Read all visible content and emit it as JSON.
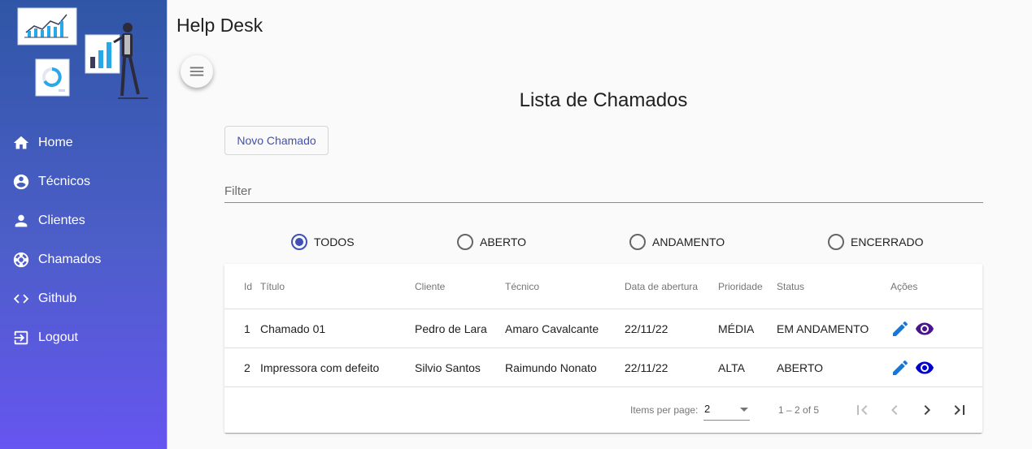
{
  "app": {
    "title": "Help Desk"
  },
  "sidebar": {
    "items": [
      {
        "label": "Home",
        "icon": "home-icon"
      },
      {
        "label": "Técnicos",
        "icon": "account-circle-icon"
      },
      {
        "label": "Clientes",
        "icon": "person-icon"
      },
      {
        "label": "Chamados",
        "icon": "support-icon"
      },
      {
        "label": "Github",
        "icon": "code-icon"
      },
      {
        "label": "Logout",
        "icon": "logout-icon"
      }
    ]
  },
  "main": {
    "heading": "Lista de Chamados",
    "new_button": "Novo Chamado",
    "filter": {
      "placeholder": "Filter",
      "value": ""
    },
    "radios": [
      {
        "label": "TODOS",
        "checked": true
      },
      {
        "label": "ABERTO",
        "checked": false
      },
      {
        "label": "ANDAMENTO",
        "checked": false
      },
      {
        "label": "ENCERRADO",
        "checked": false
      }
    ]
  },
  "table": {
    "columns": [
      "Id",
      "Título",
      "Cliente",
      "Técnico",
      "Data de abertura",
      "Prioridade",
      "Status",
      "Ações"
    ],
    "rows": [
      {
        "id": "1",
        "titulo": "Chamado 01",
        "cliente": "Pedro de Lara",
        "tecnico": "Amaro Cavalcante",
        "data": "22/11/22",
        "prioridade": "MÉDIA",
        "status": "EM ANDAMENTO"
      },
      {
        "id": "2",
        "titulo": "Impressora com defeito",
        "cliente": "Silvio Santos",
        "tecnico": "Raimundo Nonato",
        "data": "22/11/22",
        "prioridade": "ALTA",
        "status": "ABERTO"
      }
    ]
  },
  "paginator": {
    "items_per_page_label": "Items per page:",
    "page_size": "2",
    "range": "1 – 2 of 5"
  },
  "colors": {
    "accent": "#3f51b5",
    "edit_icon": "#1976d2",
    "view_icon_row1": "#4a148c",
    "view_icon_row2": "#0000cd",
    "sidebar_top": "#2f56a6",
    "sidebar_bottom": "#6655f0"
  }
}
